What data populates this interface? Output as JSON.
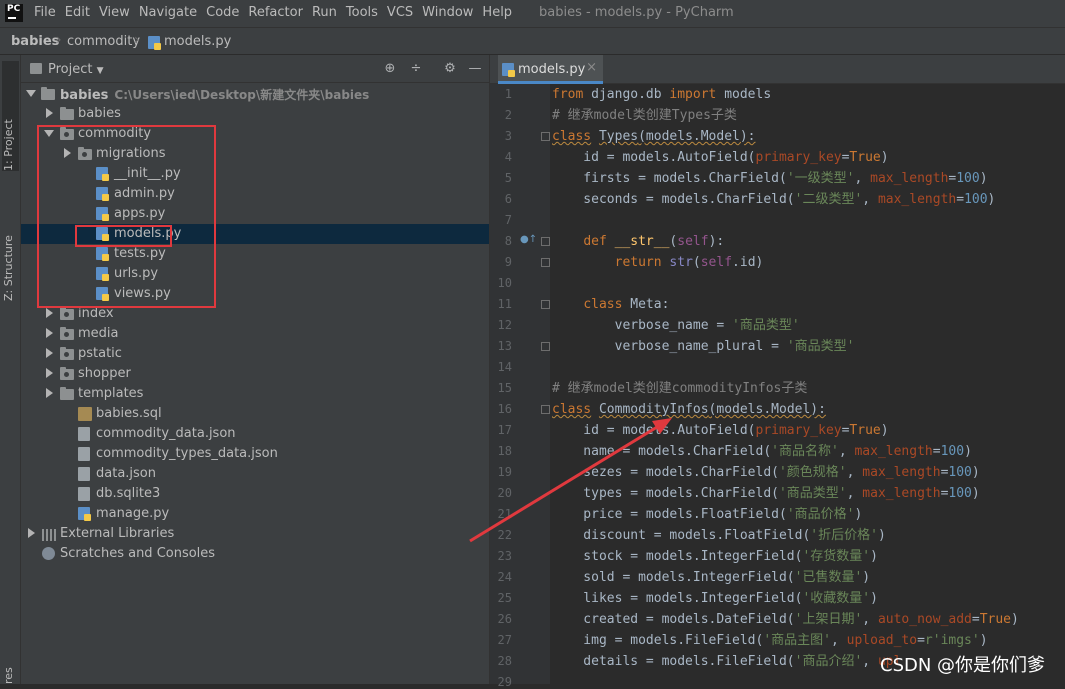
{
  "app": {
    "logo_text": "PC",
    "menu": [
      "File",
      "Edit",
      "View",
      "Navigate",
      "Code",
      "Refactor",
      "Run",
      "Tools",
      "VCS",
      "Window",
      "Help"
    ],
    "window_title": "babies - models.py - PyCharm"
  },
  "breadcrumb": {
    "items": [
      "babies",
      "commodity",
      "models.py"
    ]
  },
  "toolstrip": {
    "project_tab": "1: Project",
    "structure_tab": "Z: Structure",
    "bottom_tab": "res"
  },
  "project_panel": {
    "title": "Project",
    "root": {
      "name": "babies",
      "path": "C:\\Users\\ied\\Desktop\\新建文件夹\\babies"
    },
    "tree": [
      {
        "label": "babies",
        "depth": 1,
        "kind": "folder",
        "expand": "collapsed"
      },
      {
        "label": "commodity",
        "depth": 1,
        "kind": "folder",
        "expand": "expanded"
      },
      {
        "label": "migrations",
        "depth": 2,
        "kind": "folder",
        "expand": "collapsed"
      },
      {
        "label": "__init__.py",
        "depth": 3,
        "kind": "py"
      },
      {
        "label": "admin.py",
        "depth": 3,
        "kind": "py"
      },
      {
        "label": "apps.py",
        "depth": 3,
        "kind": "py"
      },
      {
        "label": "models.py",
        "depth": 3,
        "kind": "py",
        "selected": true
      },
      {
        "label": "tests.py",
        "depth": 3,
        "kind": "py"
      },
      {
        "label": "urls.py",
        "depth": 3,
        "kind": "py"
      },
      {
        "label": "views.py",
        "depth": 3,
        "kind": "py"
      },
      {
        "label": "index",
        "depth": 1,
        "kind": "folder",
        "expand": "collapsed"
      },
      {
        "label": "media",
        "depth": 1,
        "kind": "folder",
        "expand": "collapsed"
      },
      {
        "label": "pstatic",
        "depth": 1,
        "kind": "folder",
        "expand": "collapsed"
      },
      {
        "label": "shopper",
        "depth": 1,
        "kind": "folder",
        "expand": "collapsed"
      },
      {
        "label": "templates",
        "depth": 1,
        "kind": "folder",
        "expand": "collapsed"
      },
      {
        "label": "babies.sql",
        "depth": 2,
        "kind": "sql"
      },
      {
        "label": "commodity_data.json",
        "depth": 2,
        "kind": "data"
      },
      {
        "label": "commodity_types_data.json",
        "depth": 2,
        "kind": "data"
      },
      {
        "label": "data.json",
        "depth": 2,
        "kind": "data"
      },
      {
        "label": "db.sqlite3",
        "depth": 2,
        "kind": "data"
      },
      {
        "label": "manage.py",
        "depth": 2,
        "kind": "py"
      }
    ],
    "external_libraries": "External Libraries",
    "scratches": "Scratches and Consoles"
  },
  "editor": {
    "tab_label": "models.py",
    "tab_close": "×",
    "lines": [
      {
        "n": "1",
        "tokens": [
          [
            "kw",
            "from"
          ],
          [
            "p",
            " django.db "
          ],
          [
            "kw",
            "import"
          ],
          [
            "p",
            " models"
          ]
        ]
      },
      {
        "n": "2",
        "tokens": [
          [
            "cm",
            "# 继承model类创建Types子类"
          ]
        ]
      },
      {
        "n": "3",
        "tokens": [
          [
            "kw",
            "class"
          ],
          [
            "p",
            " "
          ],
          [
            "cls",
            "Types"
          ],
          [
            "p",
            "(models.Model):"
          ]
        ],
        "warn": true,
        "fold": true
      },
      {
        "n": "4",
        "tokens": [
          [
            "p",
            "    id = models.AutoField("
          ],
          [
            "named",
            "primary_key"
          ],
          [
            "p",
            "="
          ],
          [
            "kw",
            "True"
          ],
          [
            "p",
            ")"
          ]
        ]
      },
      {
        "n": "5",
        "tokens": [
          [
            "p",
            "    firsts = models.CharField("
          ],
          [
            "str",
            "'一级类型'"
          ],
          [
            "p",
            ", "
          ],
          [
            "named",
            "max_length"
          ],
          [
            "p",
            "="
          ],
          [
            "num",
            "100"
          ],
          [
            "p",
            ")"
          ]
        ]
      },
      {
        "n": "6",
        "tokens": [
          [
            "p",
            "    seconds = models.CharField("
          ],
          [
            "str",
            "'二级类型'"
          ],
          [
            "p",
            ", "
          ],
          [
            "named",
            "max_length"
          ],
          [
            "p",
            "="
          ],
          [
            "num",
            "100"
          ],
          [
            "p",
            ")"
          ]
        ]
      },
      {
        "n": "7",
        "tokens": []
      },
      {
        "n": "8",
        "tokens": [
          [
            "p",
            "    "
          ],
          [
            "kw",
            "def"
          ],
          [
            "p",
            " "
          ],
          [
            "fn",
            "__str__"
          ],
          [
            "p",
            "("
          ],
          [
            "slf",
            "self"
          ],
          [
            "p",
            "):"
          ]
        ],
        "fold": true,
        "override": true
      },
      {
        "n": "9",
        "tokens": [
          [
            "p",
            "        "
          ],
          [
            "kw",
            "return"
          ],
          [
            "p",
            " "
          ],
          [
            "bi",
            "str"
          ],
          [
            "p",
            "("
          ],
          [
            "slf",
            "self"
          ],
          [
            "p",
            ".id)"
          ]
        ],
        "fold": true
      },
      {
        "n": "10",
        "tokens": []
      },
      {
        "n": "11",
        "tokens": [
          [
            "p",
            "    "
          ],
          [
            "kw",
            "class"
          ],
          [
            "p",
            " Meta:"
          ]
        ],
        "fold": true
      },
      {
        "n": "12",
        "tokens": [
          [
            "p",
            "        verbose_name = "
          ],
          [
            "str",
            "'商品类型'"
          ]
        ]
      },
      {
        "n": "13",
        "tokens": [
          [
            "p",
            "        verbose_name_plural = "
          ],
          [
            "str",
            "'商品类型'"
          ]
        ],
        "fold": true
      },
      {
        "n": "14",
        "tokens": []
      },
      {
        "n": "15",
        "tokens": [
          [
            "cm",
            "# 继承model类创建commodityInfos子类"
          ]
        ]
      },
      {
        "n": "16",
        "tokens": [
          [
            "kw",
            "class"
          ],
          [
            "p",
            " "
          ],
          [
            "cls",
            "CommodityInfos"
          ],
          [
            "p",
            "(models.Model):"
          ]
        ],
        "warn": true,
        "fold": true
      },
      {
        "n": "17",
        "tokens": [
          [
            "p",
            "    id = models.AutoField("
          ],
          [
            "named",
            "primary_key"
          ],
          [
            "p",
            "="
          ],
          [
            "kw",
            "True"
          ],
          [
            "p",
            ")"
          ]
        ]
      },
      {
        "n": "18",
        "tokens": [
          [
            "p",
            "    name = models.CharField("
          ],
          [
            "str",
            "'商品名称'"
          ],
          [
            "p",
            ", "
          ],
          [
            "named",
            "max_length"
          ],
          [
            "p",
            "="
          ],
          [
            "num",
            "100"
          ],
          [
            "p",
            ")"
          ]
        ]
      },
      {
        "n": "19",
        "tokens": [
          [
            "p",
            "    sezes = models.CharField("
          ],
          [
            "str",
            "'颜色规格'"
          ],
          [
            "p",
            ", "
          ],
          [
            "named",
            "max_length"
          ],
          [
            "p",
            "="
          ],
          [
            "num",
            "100"
          ],
          [
            "p",
            ")"
          ]
        ]
      },
      {
        "n": "20",
        "tokens": [
          [
            "p",
            "    types = models.CharField("
          ],
          [
            "str",
            "'商品类型'"
          ],
          [
            "p",
            ", "
          ],
          [
            "named",
            "max_length"
          ],
          [
            "p",
            "="
          ],
          [
            "num",
            "100"
          ],
          [
            "p",
            ")"
          ]
        ]
      },
      {
        "n": "21",
        "tokens": [
          [
            "p",
            "    price = models.FloatField("
          ],
          [
            "str",
            "'商品价格'"
          ],
          [
            "p",
            ")"
          ]
        ]
      },
      {
        "n": "22",
        "tokens": [
          [
            "p",
            "    discount = models.FloatField("
          ],
          [
            "str",
            "'折后价格'"
          ],
          [
            "p",
            ")"
          ]
        ]
      },
      {
        "n": "23",
        "tokens": [
          [
            "p",
            "    stock = models.IntegerField("
          ],
          [
            "str",
            "'存货数量'"
          ],
          [
            "p",
            ")"
          ]
        ]
      },
      {
        "n": "24",
        "tokens": [
          [
            "p",
            "    sold = models.IntegerField("
          ],
          [
            "str",
            "'已售数量'"
          ],
          [
            "p",
            ")"
          ]
        ]
      },
      {
        "n": "25",
        "tokens": [
          [
            "p",
            "    likes = models.IntegerField("
          ],
          [
            "str",
            "'收藏数量'"
          ],
          [
            "p",
            ")"
          ]
        ]
      },
      {
        "n": "26",
        "tokens": [
          [
            "p",
            "    created = models.DateField("
          ],
          [
            "str",
            "'上架日期'"
          ],
          [
            "p",
            ", "
          ],
          [
            "named",
            "auto_now_add"
          ],
          [
            "p",
            "="
          ],
          [
            "kw",
            "True"
          ],
          [
            "p",
            ")"
          ]
        ]
      },
      {
        "n": "27",
        "tokens": [
          [
            "p",
            "    img = models.FileField("
          ],
          [
            "str",
            "'商品主图'"
          ],
          [
            "p",
            ", "
          ],
          [
            "named",
            "upload_to"
          ],
          [
            "p",
            "="
          ],
          [
            "str",
            "r'imgs'"
          ],
          [
            "p",
            ")"
          ]
        ]
      },
      {
        "n": "28",
        "tokens": [
          [
            "p",
            "    details = models.FileField("
          ],
          [
            "str",
            "'商品介绍'"
          ],
          [
            "p",
            ", "
          ],
          [
            "named",
            "upl"
          ]
        ]
      },
      {
        "n": "29",
        "tokens": []
      }
    ]
  },
  "watermark": "CSDN @你是你们爹",
  "colors": {
    "annotation_red": "#e0393e",
    "selection": "#0d293e",
    "keyword": "#cc7832",
    "string": "#6a8759"
  }
}
